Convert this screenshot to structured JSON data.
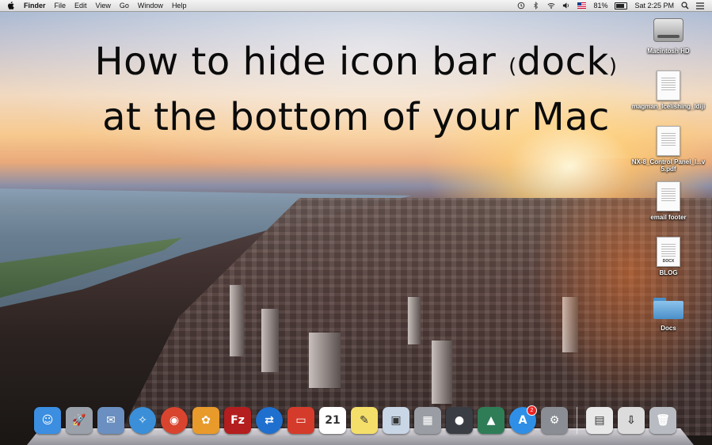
{
  "menubar": {
    "apple_icon": "apple-icon",
    "app_name": "Finder",
    "menus": [
      "File",
      "Edit",
      "View",
      "Go",
      "Window",
      "Help"
    ],
    "status": {
      "time_machine_icon": "time-machine-icon",
      "bluetooth_icon": "bluetooth-icon",
      "wifi_icon": "wifi-icon",
      "volume_icon": "volume-icon",
      "flag_icon": "us-flag-icon",
      "battery_percent": "81%",
      "battery_level": 0.81,
      "clock": "Sat 2:25 PM",
      "spotlight_icon": "search-icon",
      "notification_icon": "list-icon"
    }
  },
  "overlay": {
    "line1_before": "How to hide icon bar",
    "paren_open": "(",
    "line1_word": "dock",
    "paren_close": ")",
    "line2": "at the bottom of your Mac"
  },
  "desktop_icons": [
    {
      "label": "Macintosh HD",
      "icon": "hard-drive-icon"
    },
    {
      "label": "magman_Icelishing_Idiji",
      "icon": "document-icon"
    },
    {
      "label": "NX-8_Control Panel_I...v 5.pdf",
      "icon": "pdf-document-icon"
    },
    {
      "label": "email footer",
      "icon": "document-icon"
    },
    {
      "label": "BLOG",
      "icon": "docx-document-icon",
      "tag": "DOCX"
    },
    {
      "label": "Docs",
      "icon": "folder-icon"
    }
  ],
  "dock": {
    "apps": [
      {
        "name": "finder",
        "glyph": "☺",
        "color": "#3b8ee0"
      },
      {
        "name": "launchpad",
        "glyph": "🚀",
        "color": "#9aa1aa"
      },
      {
        "name": "mail",
        "glyph": "✉",
        "color": "#6a8fc0"
      },
      {
        "name": "safari",
        "glyph": "✧",
        "color": "#3a8fd8"
      },
      {
        "name": "chrome",
        "glyph": "◉",
        "color": "#d9442f"
      },
      {
        "name": "photos",
        "glyph": "✿",
        "color": "#e89a2b"
      },
      {
        "name": "filezilla",
        "glyph": "Fz",
        "color": "#b41e1e"
      },
      {
        "name": "teamviewer",
        "glyph": "⇄",
        "color": "#1f6fcf"
      },
      {
        "name": "screen-sharing",
        "glyph": "▭",
        "color": "#d43b2a"
      },
      {
        "name": "calendar",
        "glyph": "21",
        "color": "#ffffff"
      },
      {
        "name": "stickies",
        "glyph": "✎",
        "color": "#f4df6a"
      },
      {
        "name": "preview",
        "glyph": "▣",
        "color": "#c8d6e6"
      },
      {
        "name": "calculator",
        "glyph": "▦",
        "color": "#9a9ea4"
      },
      {
        "name": "facetime",
        "glyph": "●",
        "color": "#3a3e44"
      },
      {
        "name": "iphoto",
        "glyph": "▲",
        "color": "#2e7d57"
      },
      {
        "name": "app-store",
        "glyph": "A",
        "color": "#2f8fe6",
        "badge": "2"
      },
      {
        "name": "system-preferences",
        "glyph": "⚙",
        "color": "#8a8e94"
      }
    ],
    "right_items": [
      {
        "name": "document-stack",
        "glyph": "▤",
        "color": "#e8e8e8"
      },
      {
        "name": "downloads-stack",
        "glyph": "⇩",
        "color": "#dcdcdc"
      },
      {
        "name": "trash",
        "glyph": "🗑",
        "color": "#b8bcc2"
      }
    ]
  }
}
